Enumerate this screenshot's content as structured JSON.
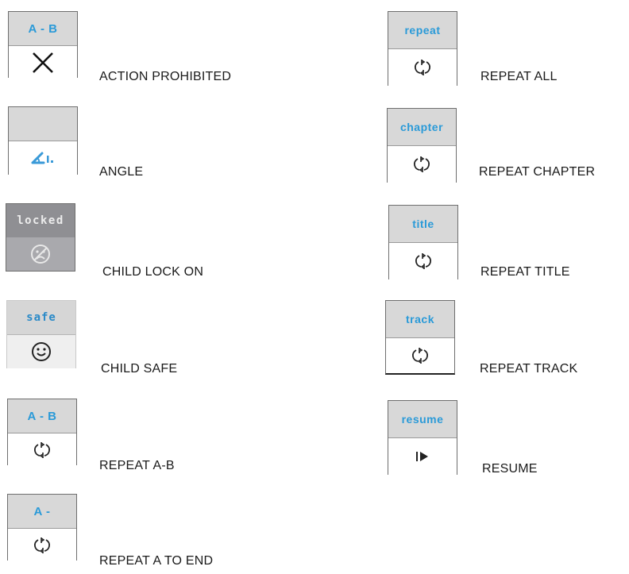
{
  "left": [
    {
      "top_text": "A - B",
      "icon": "x-icon",
      "label": "ACTION PROHIBITED"
    },
    {
      "top_text": "",
      "icon": "angle-icon",
      "label": "ANGLE"
    },
    {
      "top_text": "locked",
      "icon": "sad-face-icon",
      "label": "CHILD LOCK ON"
    },
    {
      "top_text": "safe",
      "icon": "smiley-face-icon",
      "label": "CHILD SAFE"
    },
    {
      "top_text": "A - B",
      "icon": "repeat-icon",
      "label": "REPEAT A-B"
    },
    {
      "top_text": "A -",
      "icon": "repeat-icon",
      "label": "REPEAT A TO END"
    }
  ],
  "right": [
    {
      "top_text": "repeat",
      "icon": "repeat-icon",
      "label": "REPEAT ALL"
    },
    {
      "top_text": "chapter",
      "icon": "repeat-icon",
      "label": "REPEAT CHAPTER"
    },
    {
      "top_text": "title",
      "icon": "repeat-icon",
      "label": "REPEAT TITLE"
    },
    {
      "top_text": "track",
      "icon": "repeat-icon",
      "label": "REPEAT TRACK"
    },
    {
      "top_text": "resume",
      "icon": "resume-play-icon",
      "label": "RESUME"
    }
  ],
  "colors": {
    "accent": "#2a9ad8",
    "locked_bg": "#8f8f93",
    "frame_top": "#d8d8d8"
  }
}
